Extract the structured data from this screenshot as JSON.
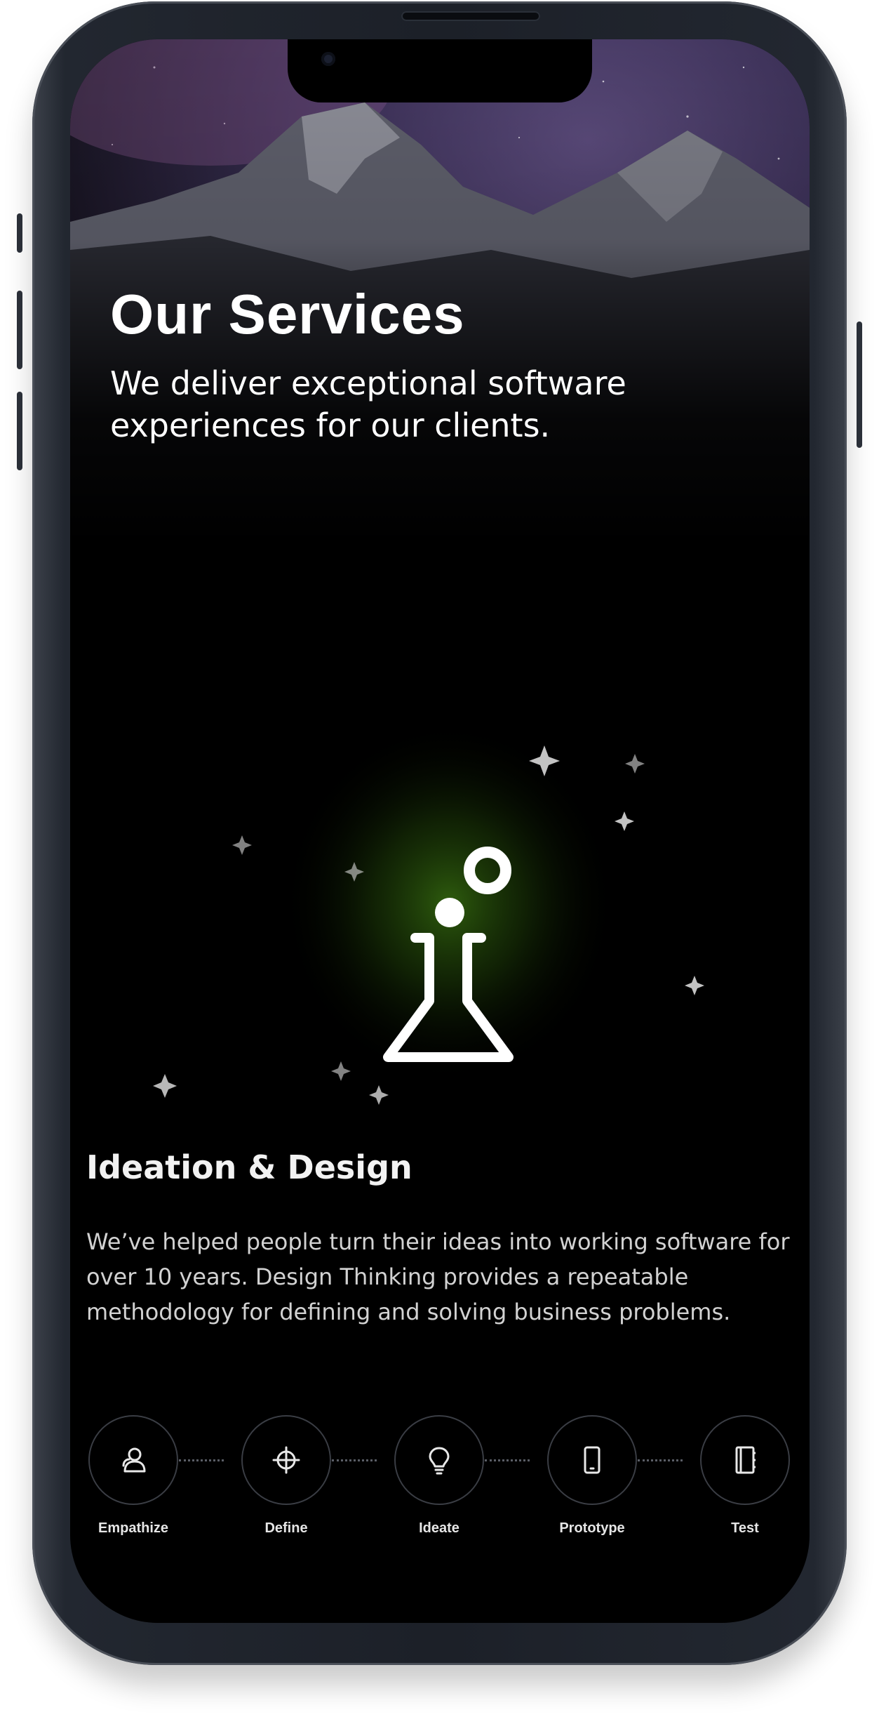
{
  "hero": {
    "title": "Our Services",
    "subtitle": "We deliver exceptional software experiences for our clients."
  },
  "section": {
    "icon": "flask-icon",
    "title": "Ideation & Design",
    "description": "We’ve helped people turn their ideas into working software for over 10 years. Design Thinking provides a repeatable methodology for defining and solving business problems."
  },
  "process": {
    "steps": [
      {
        "label": "Empathize",
        "icon": "person-icon"
      },
      {
        "label": "Define",
        "icon": "crosshair-icon"
      },
      {
        "label": "Ideate",
        "icon": "lightbulb-icon"
      },
      {
        "label": "Prototype",
        "icon": "phone-icon"
      },
      {
        "label": "Test",
        "icon": "notebook-icon"
      }
    ]
  },
  "colors": {
    "background": "#000000",
    "accent_glow": "#3d7a12",
    "text": "#ffffff"
  }
}
